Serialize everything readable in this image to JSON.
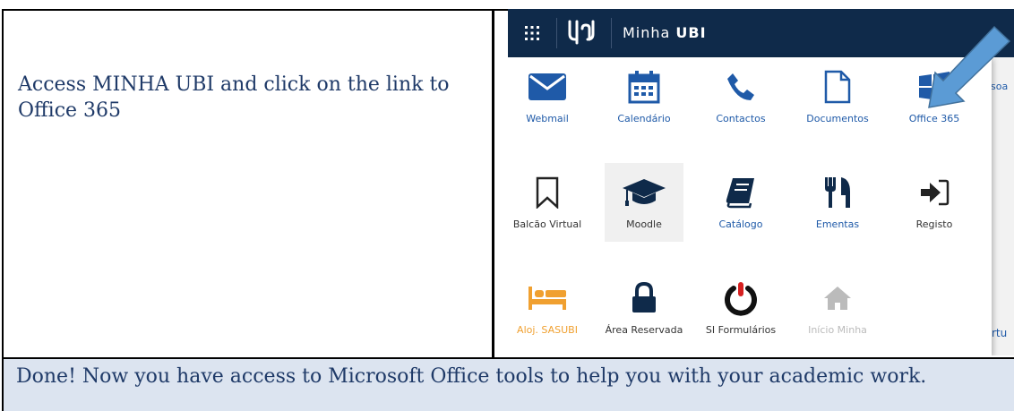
{
  "instruction": "Access MINHA UBI and click on the link to Office 365",
  "conclusion": "Done! Now you have access to Microsoft Office tools to help you with your academic work.",
  "screenshot": {
    "app_title_prefix": "Minha ",
    "app_title_bold": "UBI",
    "background_fragment_top": "soa",
    "background_fragment_bottom": "rtu",
    "apps": [
      {
        "label": "Webmail",
        "icon": "envelope-icon",
        "color": "#1f5aa8"
      },
      {
        "label": "Calendário",
        "icon": "calendar-icon",
        "color": "#1f5aa8"
      },
      {
        "label": "Contactos",
        "icon": "phone-icon",
        "color": "#1f5aa8"
      },
      {
        "label": "Documentos",
        "icon": "document-icon",
        "color": "#1f5aa8"
      },
      {
        "label": "Office 365",
        "icon": "windows-icon",
        "color": "#1f5aa8"
      },
      {
        "label": "Balcão Virtual",
        "icon": "bookmark-icon",
        "color": "#333333"
      },
      {
        "label": "Moodle",
        "icon": "graduation-cap-icon",
        "color": "#333333"
      },
      {
        "label": "Catálogo",
        "icon": "book-icon",
        "color": "#1f5aa8"
      },
      {
        "label": "Ementas",
        "icon": "cutlery-icon",
        "color": "#1f5aa8"
      },
      {
        "label": "Registo",
        "icon": "sign-in-icon",
        "color": "#1f5aa8"
      },
      {
        "label": "Aloj. SASUBI",
        "icon": "bed-icon",
        "color": "#f0a030"
      },
      {
        "label": "Área Reservada",
        "icon": "lock-icon",
        "color": "#333333"
      },
      {
        "label": "SI Formulários",
        "icon": "power-icon",
        "color": "#333333"
      },
      {
        "label": "Início Minha",
        "icon": "home-icon",
        "color": "#bbbbbb"
      }
    ],
    "arrow_color": "#5b9bd5"
  }
}
